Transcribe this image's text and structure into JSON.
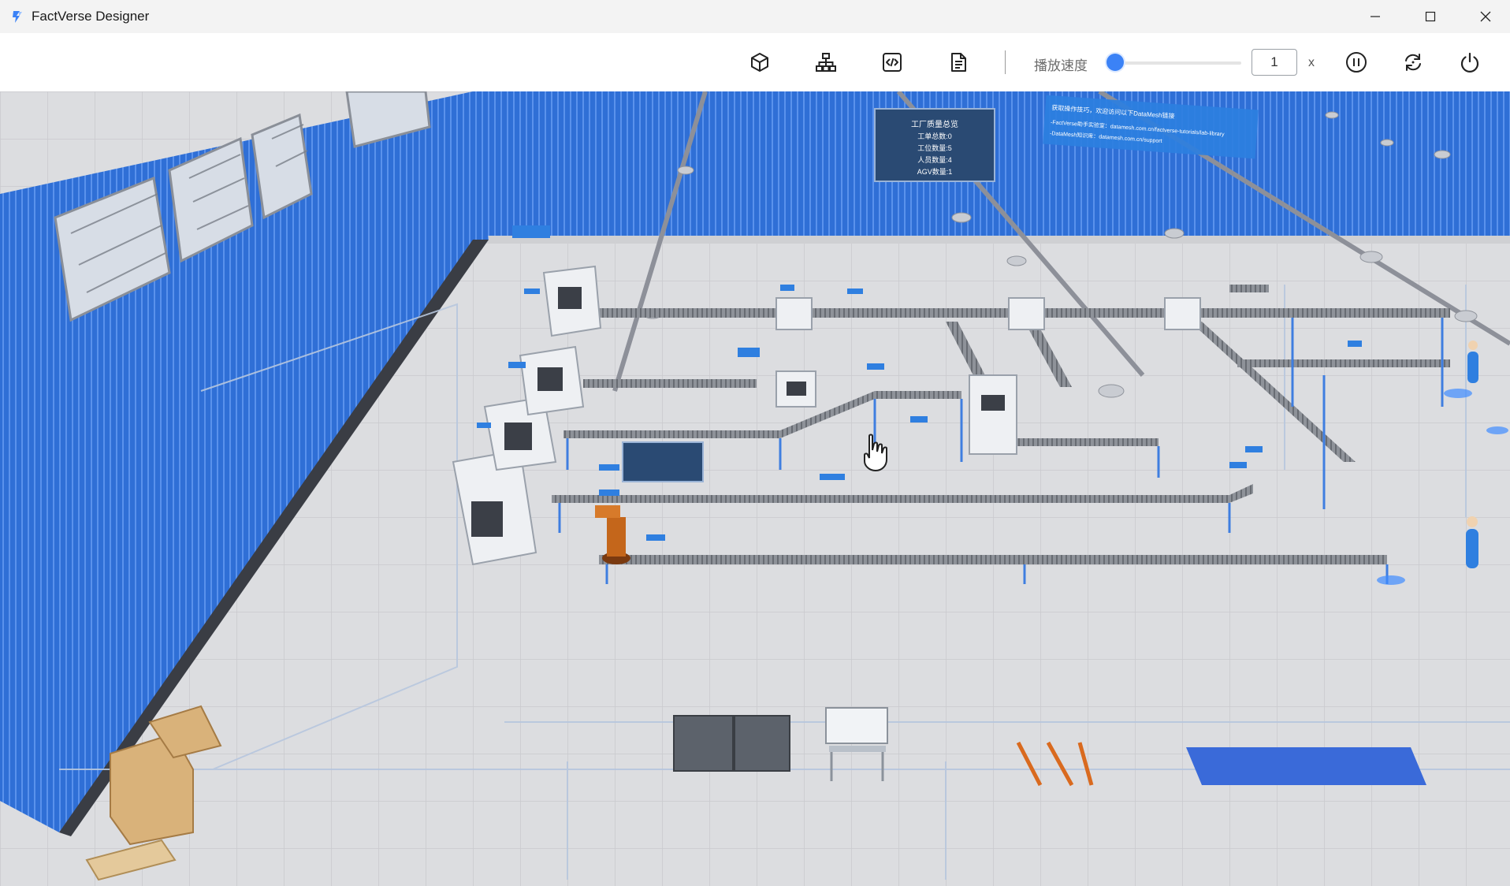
{
  "app": {
    "title": "FactVerse Designer"
  },
  "window_controls": {
    "minimize_icon": "minimize-icon",
    "maximize_icon": "maximize-icon",
    "close_icon": "close-icon"
  },
  "toolbar": {
    "icons": [
      "cube-icon",
      "hierarchy-icon",
      "code-icon",
      "document-icon",
      "pause-icon",
      "refresh-icon",
      "power-icon"
    ],
    "speed_label": "播放速度",
    "speed_value": "1",
    "speed_unit": "x",
    "speed_slider_position": 0,
    "accent_color": "#3b82f6"
  },
  "scene": {
    "stats_board": {
      "title": "工厂质量总览",
      "lines": [
        "工单总数:0",
        "工位数量:5",
        "人员数量:4",
        "AGV数量:1"
      ]
    },
    "info_banner": {
      "lines": [
        "获取操作技巧，欢迎访问以下DataMesh链接",
        "-FactVerse助手实验室：datamesh.com.cn/factverse-tutorials/lab-library",
        "-DataMesh知识库：datamesh.com.cn/support"
      ]
    },
    "wall_color": "#2f6fd6",
    "floor_color": "#d9dadd",
    "conveyor_color": "#5c8fe0"
  }
}
